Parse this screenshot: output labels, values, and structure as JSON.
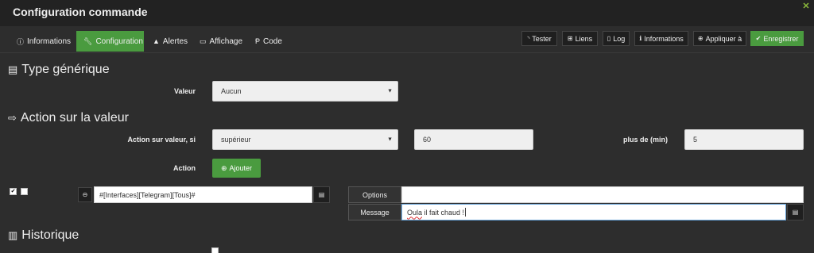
{
  "window": {
    "title": "Configuration commande"
  },
  "tabs": [
    {
      "label": "Informations",
      "icon": "info-circle-icon"
    },
    {
      "label": "Configuration",
      "icon": "wrench-icon",
      "active": true
    },
    {
      "label": "Alertes",
      "icon": "warning-icon"
    },
    {
      "label": "Affichage",
      "icon": "desktop-icon"
    },
    {
      "label": "Code",
      "icon": "code-icon"
    }
  ],
  "toolbar": {
    "tester": "Tester",
    "liens": "Liens",
    "log": "Log",
    "informations": "Informations",
    "appliquer": "Appliquer à",
    "enregistrer": "Enregistrer"
  },
  "type_generique": {
    "title": "Type générique",
    "valeur_label": "Valeur",
    "valeur_value": "Aucun"
  },
  "action_valeur": {
    "title": "Action sur la valeur",
    "condition_label": "Action sur valeur, si",
    "condition_value": "supérieur",
    "threshold_value": "60",
    "duration_label": "plus de (min)",
    "duration_value": "5",
    "action_label": "Action",
    "add_button": "Ajouter"
  },
  "action_row": {
    "command": "#[Interfaces][Telegram][Tous]#",
    "options_label": "Options",
    "options_value": "",
    "message_label": "Message",
    "message_word1": "Oula",
    "message_rest": " il fait chaud !"
  },
  "historique": {
    "title": "Historique"
  },
  "colors": {
    "accent": "#4a9b3f",
    "background": "#2d2d2d",
    "titlebar": "#222222"
  }
}
